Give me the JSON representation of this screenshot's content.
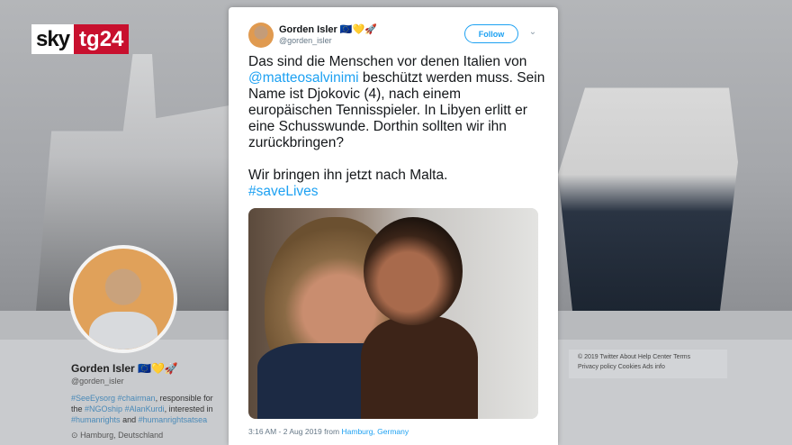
{
  "brand": {
    "logo_sky": "sky",
    "logo_tg": "tg24"
  },
  "profile": {
    "name": "Gorden Isler",
    "name_emojis": "🇪🇺💛🚀",
    "handle": "@gorden_isler",
    "bio_link1": "#SeeEysorg",
    "bio_link2": "#chairman",
    "bio_text1": ", responsible for the",
    "bio_link3": "#NGOship",
    "bio_link4": "#AlanKurdi",
    "bio_text2": ", interested in",
    "bio_link5": "#humanrights",
    "bio_text3": "and",
    "bio_link6": "#humanrightsatsea",
    "location": "Hamburg, Deutschland"
  },
  "footer": {
    "line1": "© 2019 Twitter   About   Help Center   Terms",
    "line2": "Privacy policy   Cookies   Ads info"
  },
  "tweet": {
    "author_name": "Gorden Isler",
    "author_emojis": "🇪🇺💛🚀",
    "author_handle": "@gorden_isler",
    "follow_label": "Follow",
    "chevron": "⌄",
    "text_p1_before": "Das sind die Menschen vor denen Italien von",
    "text_mention": "@matteosalvinimi",
    "text_p1_after": "beschützt werden muss. Sein Name ist Djokovic (4), nach einem europäischen Tennisspieler. In Libyen erlitt er eine Schusswunde. Dorthin sollten wir ihn zurückbringen?",
    "text_p2": "Wir bringen ihn jetzt nach Malta.",
    "hashtag": "#saveLives",
    "timestamp": "3:16 AM - 2 Aug 2019 from",
    "location_link": "Hamburg, Germany"
  },
  "colors": {
    "twitter_blue": "#1da1f2",
    "tg24_red": "#c8102e"
  }
}
